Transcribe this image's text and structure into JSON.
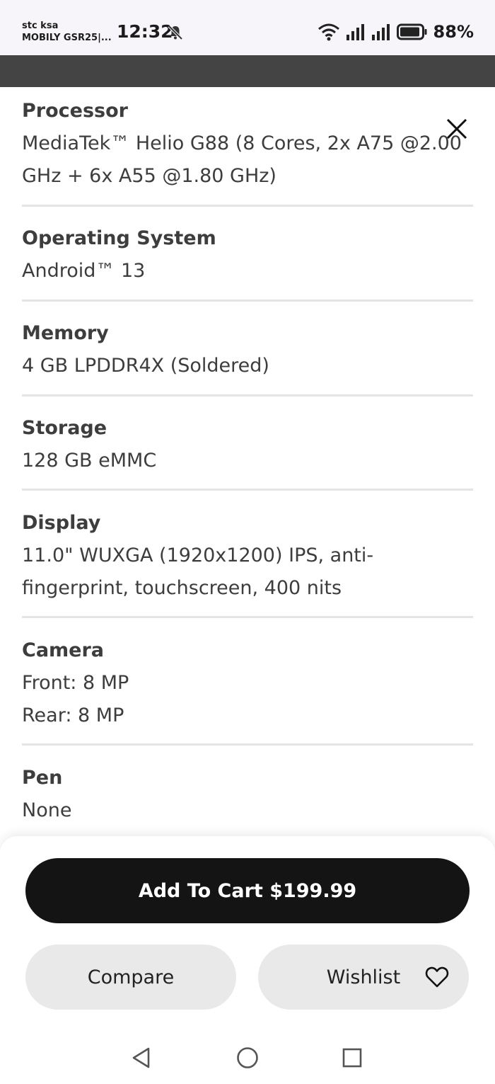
{
  "status_bar": {
    "carrier_line1": "stc ksa",
    "carrier_line2": "MOBILY GSR25|...",
    "time": "12:32",
    "battery": "88%"
  },
  "specs": [
    {
      "label": "Processor",
      "lines": [
        "MediaTek™ Helio G88 (8 Cores, 2x A75 @2.00",
        "GHz + 6x A55 @1.80 GHz)"
      ]
    },
    {
      "label": "Operating System",
      "lines": [
        "Android™ 13"
      ]
    },
    {
      "label": "Memory",
      "lines": [
        "4 GB LPDDR4X (Soldered)"
      ]
    },
    {
      "label": "Storage",
      "lines": [
        "128 GB eMMC"
      ]
    },
    {
      "label": "Display",
      "lines": [
        "11.0\" WUXGA (1920x1200) IPS, anti-",
        "fingerprint, touchscreen, 400 nits"
      ]
    },
    {
      "label": "Camera",
      "lines": [
        "Front: 8 MP",
        "Rear: 8 MP"
      ]
    },
    {
      "label": "Pen",
      "lines": [
        "None"
      ]
    }
  ],
  "actions": {
    "add_to_cart": "Add To Cart $199.99",
    "compare": "Compare",
    "wishlist": "Wishlist"
  },
  "icons": {
    "close": "close-icon",
    "wishlist": "heart-icon",
    "nav": [
      "back-triangle-icon",
      "home-circle-icon",
      "recents-square-icon"
    ]
  },
  "colors": {
    "cart_button": "#141414",
    "pill_button": "#e9e9e9",
    "header_band": "#444444"
  }
}
